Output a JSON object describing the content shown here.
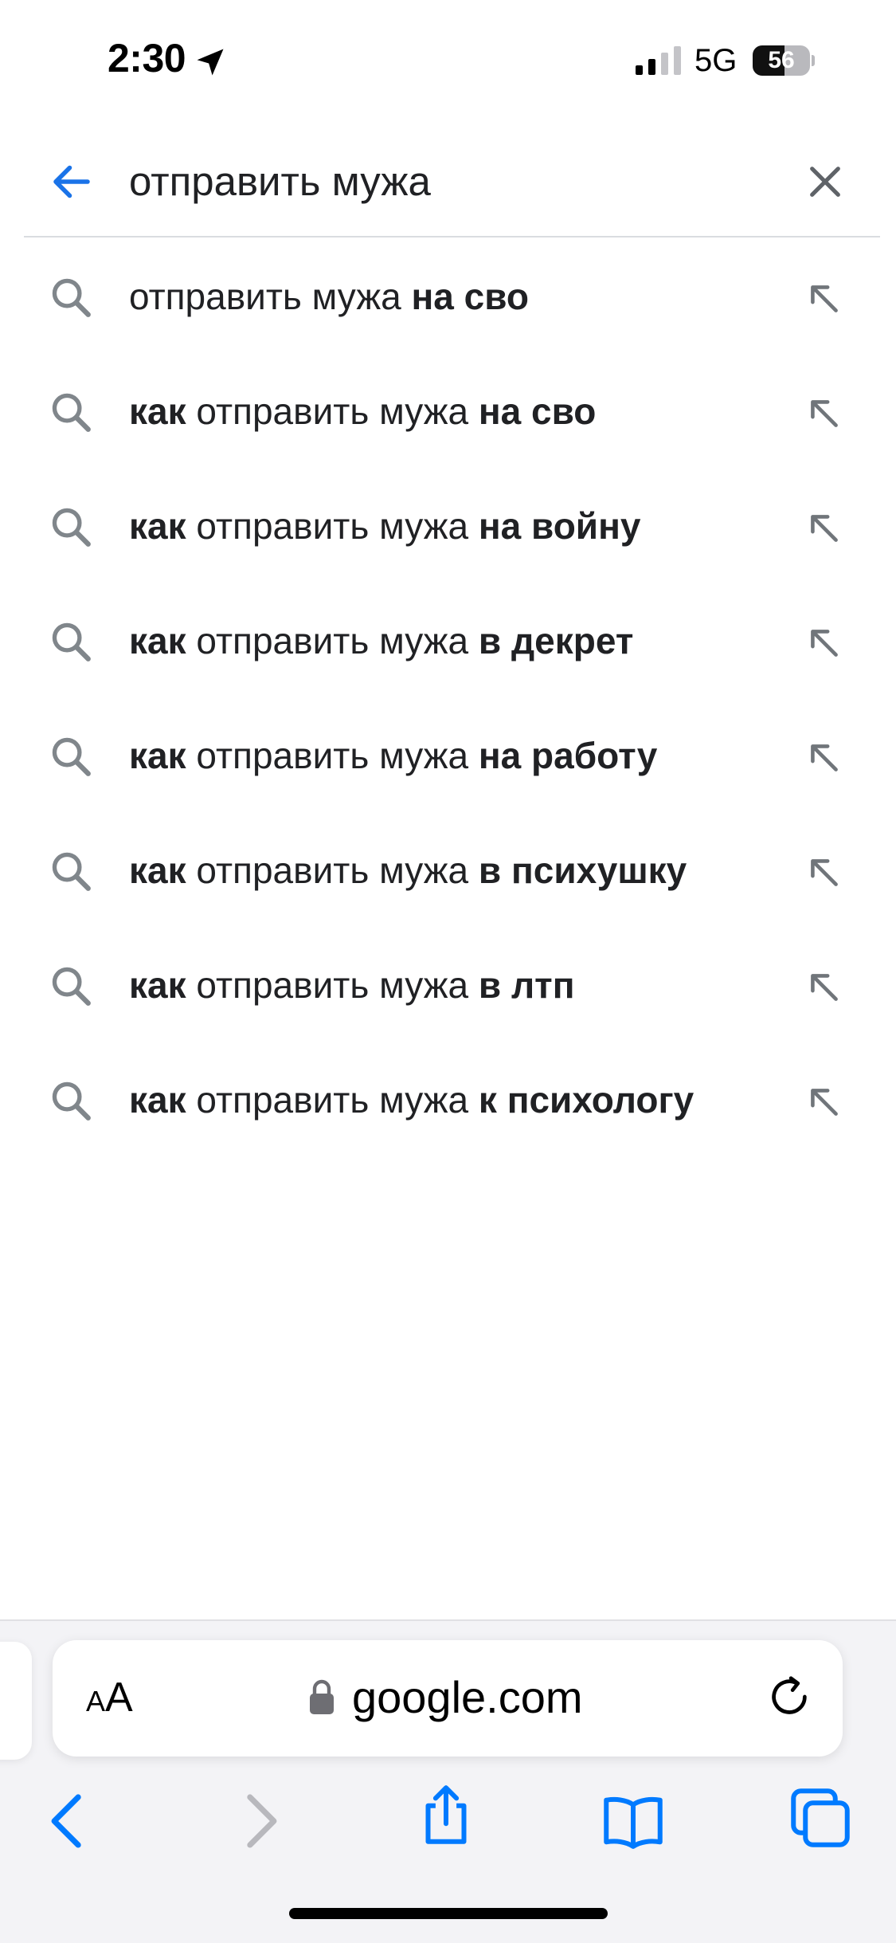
{
  "status_bar": {
    "time": "2:30",
    "network": "5G",
    "battery_level": 56,
    "battery_text": "56",
    "location_icon": "location-arrow-icon",
    "signal_icon": "cellular-signal-icon"
  },
  "search": {
    "query": "отправить мужа",
    "back_icon": "back-arrow-icon",
    "clear_icon": "close-icon",
    "accent_color": "#1a73e8"
  },
  "suggestions": [
    {
      "prefix": "",
      "middle": "отправить мужа",
      "suffix": " на сво"
    },
    {
      "prefix": "как",
      "middle": " отправить мужа",
      "suffix": " на сво"
    },
    {
      "prefix": "как",
      "middle": " отправить мужа",
      "suffix": " на войну"
    },
    {
      "prefix": "как",
      "middle": " отправить мужа",
      "suffix": " в декрет"
    },
    {
      "prefix": "как",
      "middle": " отправить мужа",
      "suffix": " на работу"
    },
    {
      "prefix": "как",
      "middle": " отправить мужа",
      "suffix": " в психушку"
    },
    {
      "prefix": "как",
      "middle": " отправить мужа",
      "suffix": " в лтп"
    },
    {
      "prefix": "как",
      "middle": " отправить мужа",
      "suffix": " к психологу"
    }
  ],
  "browser": {
    "aa_small": "A",
    "aa_large": "A",
    "url": "google.com",
    "icons": [
      "back-chevron-icon",
      "forward-chevron-icon",
      "share-icon",
      "bookmarks-icon",
      "tabs-icon",
      "reload-icon",
      "lock-icon"
    ],
    "tint_color": "#007aff"
  }
}
